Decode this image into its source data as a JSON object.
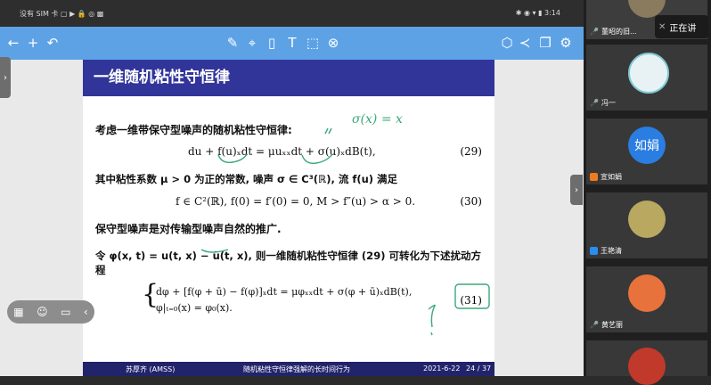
{
  "status_bar": {
    "left": "没有 SIM 卡 ▢ ▶ 🔒 ◎ ▩",
    "right": "✱ ◉ ▾ ▮ 3:14"
  },
  "toolbar": {
    "icons": [
      "back-arrow-icon",
      "add-icon",
      "undo-icon",
      "pen-icon",
      "marker-icon",
      "phone-icon",
      "text-icon",
      "select-icon",
      "erase-icon",
      "shape-icon",
      "share-icon",
      "copy-icon",
      "settings-icon"
    ]
  },
  "slide": {
    "title": "一维随机粘性守恒律",
    "para1": "考虑一维带保守型噪声的随机粘性守恒律:",
    "eq1": "du + f(u)ₓdt = μuₓₓdt + σ(u)ₓdB(t),",
    "eq1_num": "(29)",
    "para2": "其中粘性系数 μ > 0 为正的常数, 噪声 σ ∈ C³(ℝ), 流 f(u) 满足",
    "eq2": "f ∈ C²(ℝ), f(0) = f′(0) = 0, M > f″(u) > α > 0.",
    "eq2_num": "(30)",
    "para3": "保守型噪声是对传输型噪声自然的推广.",
    "para4a": "令 φ(x, t) = u(t, x) − ū(t, x), 则一维随机粘性守恒律 (29) 可转化为下述扰动方",
    "para4b": "程",
    "sys1": "dφ + [f(φ + ū) − f(φ)]ₓdt = μφₓₓdt + σ(φ + ū)ₓdB(t),",
    "sys2": "φ|ₜ₌₀(x) = φ₀(x).",
    "eq3_num": "(31)",
    "footer_left": "苏厚齐 (AMSS)",
    "footer_mid": "随机粘性守恒律强解的长时间行为",
    "footer_date": "2021-6-22",
    "footer_page": "24 / 37",
    "handwriting": [
      "σ(x) = x",
      "//",
      "?"
    ]
  },
  "participants": [
    {
      "name": "董昭的旧...",
      "type": "photo"
    },
    {
      "name": "冯一",
      "type": "cartoon"
    },
    {
      "name": "宣如娟",
      "type": "initials",
      "initials": "如娟"
    },
    {
      "name": "王艳清",
      "type": "photo"
    },
    {
      "name": "黄艺丽",
      "type": "cartoon"
    },
    {
      "name": "",
      "type": "cartoon"
    }
  ],
  "speaking_label": "正在讲",
  "colors": {
    "toolbar": "#5ea2e6",
    "slide_title": "#31359a",
    "footer": "#21236b",
    "ink": "#3aa87a"
  }
}
